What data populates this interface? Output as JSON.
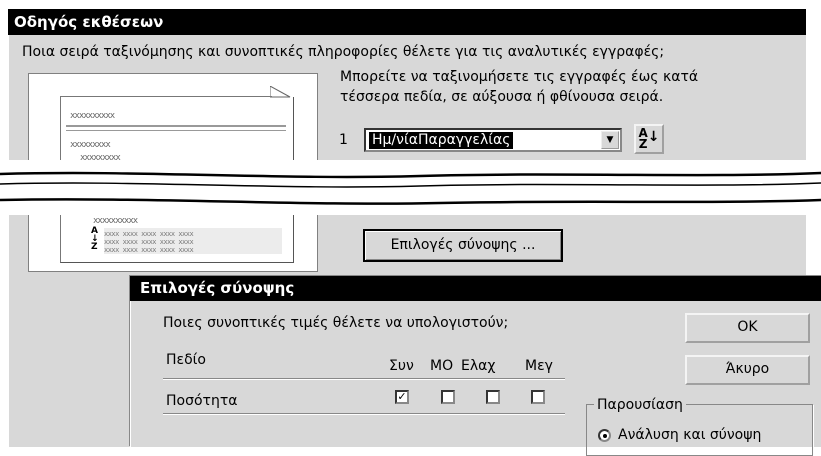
{
  "wizard": {
    "title": "Οδηγός εκθέσεων",
    "question": "Ποια σειρά ταξινόμησης και συνοπτικές πληροφορίες θέλετε για τις αναλυτικές εγγραφές;",
    "hint_line1": "Μπορείτε να ταξινομήσετε τις εγγραφές έως κατά",
    "hint_line2": "τέσσερα πεδία, σε αύξουσα ή φθίνουσα σειρά.",
    "sort_number": "1",
    "sort_field": "Ημ/νίαΠαραγγελίας",
    "sort_icon": "sort-ascending-icon",
    "summary_button": "Επιλογές σύνοψης ...",
    "preview": {
      "placeholder_long": "xxxxxxxxxx",
      "placeholder_mid": "xxxxxxxxx",
      "cell": "xxxx",
      "sort_glyph_top": "A",
      "sort_glyph_bottom": "Z"
    }
  },
  "summary_dialog": {
    "title": "Επιλογές σύνοψης",
    "question": "Ποιες συνοπτικές τιμές θέλετε να υπολογιστούν;",
    "ok_label": "OK",
    "cancel_label": "Άκυρο",
    "columns": {
      "field": "Πεδίο",
      "sum": "Συν",
      "avg": "ΜΟ",
      "min": "Ελαχ",
      "max": "Μεγ"
    },
    "row_field": "Ποσότητα",
    "row_checked": {
      "sum": true,
      "avg": false,
      "min": false,
      "max": false
    },
    "group_label": "Παρουσίαση",
    "radio_label": "Ανάλυση και σύνοψη",
    "radio_selected": true
  }
}
